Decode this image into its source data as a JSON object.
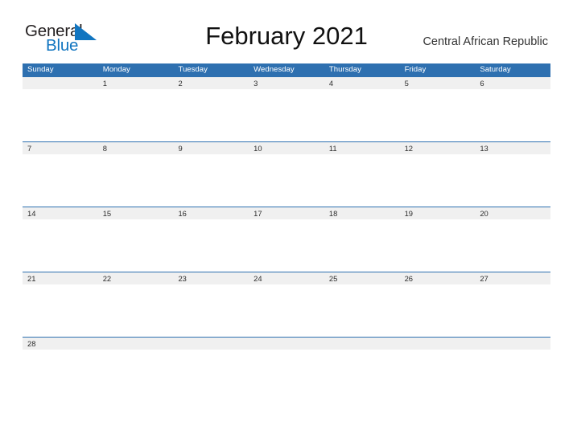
{
  "brand": {
    "name_part1": "General",
    "name_part2": "Blue",
    "flag_icon": "triangle-flag-icon",
    "blue_hex": "#1175c0",
    "dark_hex": "#231f20"
  },
  "header": {
    "title": "February 2021",
    "country": "Central African Republic"
  },
  "calendar": {
    "month": "February",
    "year": "2021",
    "header_bg_hex": "#2E70B0",
    "date_strip_hex": "#F0F0F0",
    "weekdays": [
      "Sunday",
      "Monday",
      "Tuesday",
      "Wednesday",
      "Thursday",
      "Friday",
      "Saturday"
    ],
    "weeks": [
      [
        "",
        "1",
        "2",
        "3",
        "4",
        "5",
        "6"
      ],
      [
        "7",
        "8",
        "9",
        "10",
        "11",
        "12",
        "13"
      ],
      [
        "14",
        "15",
        "16",
        "17",
        "18",
        "19",
        "20"
      ],
      [
        "21",
        "22",
        "23",
        "24",
        "25",
        "26",
        "27"
      ],
      [
        "28",
        "",
        "",
        "",
        "",
        "",
        ""
      ]
    ]
  }
}
